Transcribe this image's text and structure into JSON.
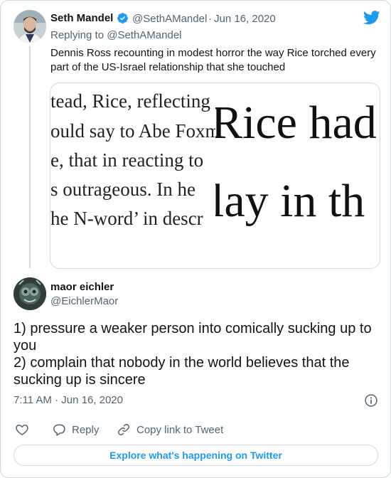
{
  "colors": {
    "accent": "#1d9bf0",
    "text_primary": "#0f1419",
    "text_secondary": "#536471",
    "border": "#cfd9de"
  },
  "tweet1": {
    "author_name": "Seth Mandel",
    "verified": true,
    "handle": "@SethAMandel",
    "separator": "·",
    "date": "Jun 16, 2020",
    "replying_prefix": "Replying to ",
    "replying_to": "@SethAMandel",
    "text": "Dennis Ross recounting in modest horror the way Rice torched every part of the US-Israel relationship that she touched",
    "media": {
      "left_lines": [
        "tead, Rice, reflecting",
        "ould say to Abe Foxm",
        "e, that in reacting to",
        "s outrageous. In he",
        "he N-word’ in descr"
      ],
      "right_lines": [
        "Rice had",
        "lay in th"
      ]
    }
  },
  "tweet2": {
    "author_name": "maor eichler",
    "handle": "@EichlerMaor",
    "text_lines": [
      "1) pressure a weaker person into comically sucking up to you",
      "2) complain that nobody in the world believes that the sucking up is sincere"
    ],
    "timestamp": "7:11 AM · Jun 16, 2020"
  },
  "actions": {
    "reply_label": "Reply",
    "copy_label": "Copy link to Tweet"
  },
  "explore_label": "Explore what's happening on Twitter",
  "icons": {
    "logo": "twitter-bird-icon",
    "verified": "verified-badge-icon",
    "info": "info-icon",
    "like": "heart-icon",
    "reply": "reply-bubble-icon",
    "copy": "link-icon"
  }
}
